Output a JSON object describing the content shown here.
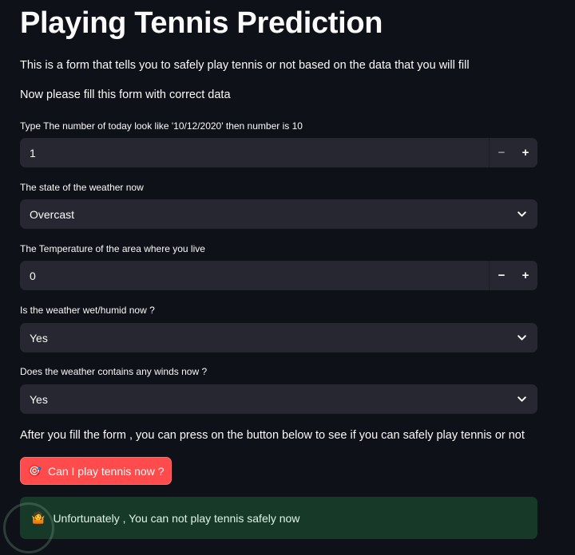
{
  "title": "Playing Tennis Prediction",
  "intro": "This is a form that tells you to safely play tennis or not based on the data that you will fill",
  "instruction": "Now please fill this form with correct data",
  "fields": {
    "day": {
      "label": "Type The number of today look like '10/12/2020' then number is 10",
      "value": "1",
      "minus": "−",
      "plus": "+"
    },
    "weather": {
      "label": "The state of the weather now",
      "value": "Overcast"
    },
    "temperature": {
      "label": "The Temperature of the area where you live",
      "value": "0",
      "minus": "−",
      "plus": "+"
    },
    "humid": {
      "label": "Is the weather wet/humid now ?",
      "value": "Yes"
    },
    "wind": {
      "label": "Does the weather contains any winds now ?",
      "value": "Yes"
    }
  },
  "after_text": "After you fill the form , you can press on the button below to see if you can safely play tennis or not",
  "button": {
    "icon": "🎯",
    "label": "Can I play tennis now ?"
  },
  "result": {
    "icon": "🤷",
    "text": "Unfortunately , You can not play tennis safely now"
  },
  "colors": {
    "background": "#0e1117",
    "input": "#262730",
    "button": "#ff4b4b",
    "alert": "#173928"
  }
}
